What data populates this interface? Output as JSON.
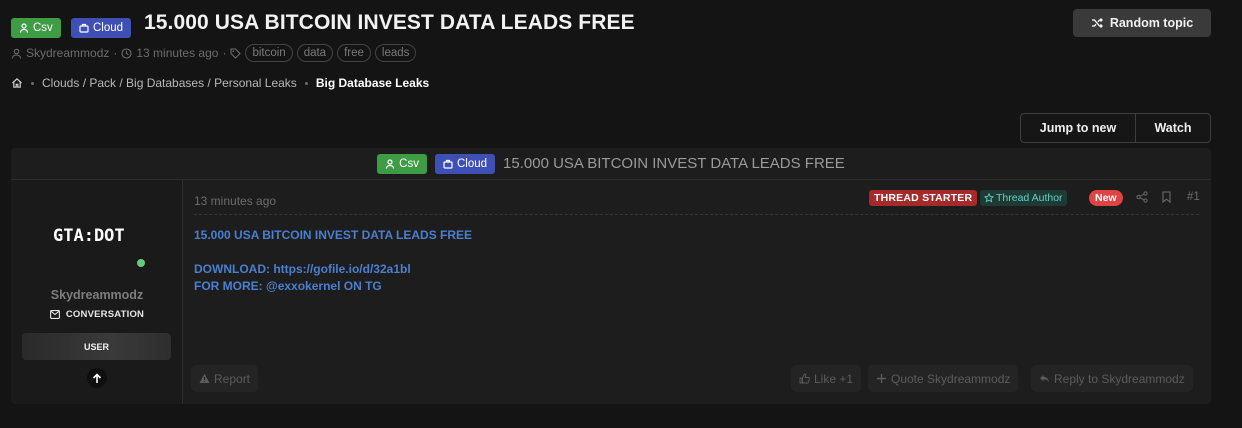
{
  "thread": {
    "prefixes": [
      {
        "label": "Csv",
        "icon": "user-icon",
        "color": "#3e9c45"
      },
      {
        "label": "Cloud",
        "icon": "briefcase-icon",
        "color": "#3f50b5"
      }
    ],
    "title": "15.000 USA BITCOIN INVEST DATA LEADS FREE",
    "author": "Skydreammodz",
    "time": "13 minutes ago",
    "tags": [
      "bitcoin",
      "data",
      "free",
      "leads"
    ]
  },
  "breadcrumb": {
    "home_icon": "home-icon",
    "items": [
      "Clouds / Pack / Big Databases / Personal Leaks",
      "Big Database Leaks"
    ]
  },
  "header_actions": {
    "random_topic": "Random topic"
  },
  "thread_actions": {
    "jump_to_new": "Jump to new",
    "watch": "Watch"
  },
  "post": {
    "header_title": "15.000 USA BITCOIN INVEST DATA LEADS FREE",
    "time": "13 minutes ago",
    "labels": {
      "starter": "THREAD STARTER",
      "author": "Thread Author",
      "new": "New"
    },
    "number": "#1",
    "body": [
      "15.000 USA BITCOIN INVEST DATA LEADS FREE",
      "DOWNLOAD: https://gofile.io/d/32a1bl",
      "FOR MORE: @exxokernel ON TG"
    ],
    "actions": {
      "report": "Report",
      "like": "Like +1",
      "quote": "Quote Skydreammodz",
      "reply": "Reply to Skydreammodz"
    }
  },
  "user": {
    "avatar_text": "GTA:DOT",
    "name": "Skydreammodz",
    "conversation": "CONVERSATION",
    "banner": "USER",
    "status": "online"
  },
  "colors": {
    "accent_link": "#4a7fd1",
    "starter_label": "#a52a2a",
    "new_label": "#e04343",
    "author_label_text": "#5fd3c6",
    "online_dot": "#69c97a"
  }
}
